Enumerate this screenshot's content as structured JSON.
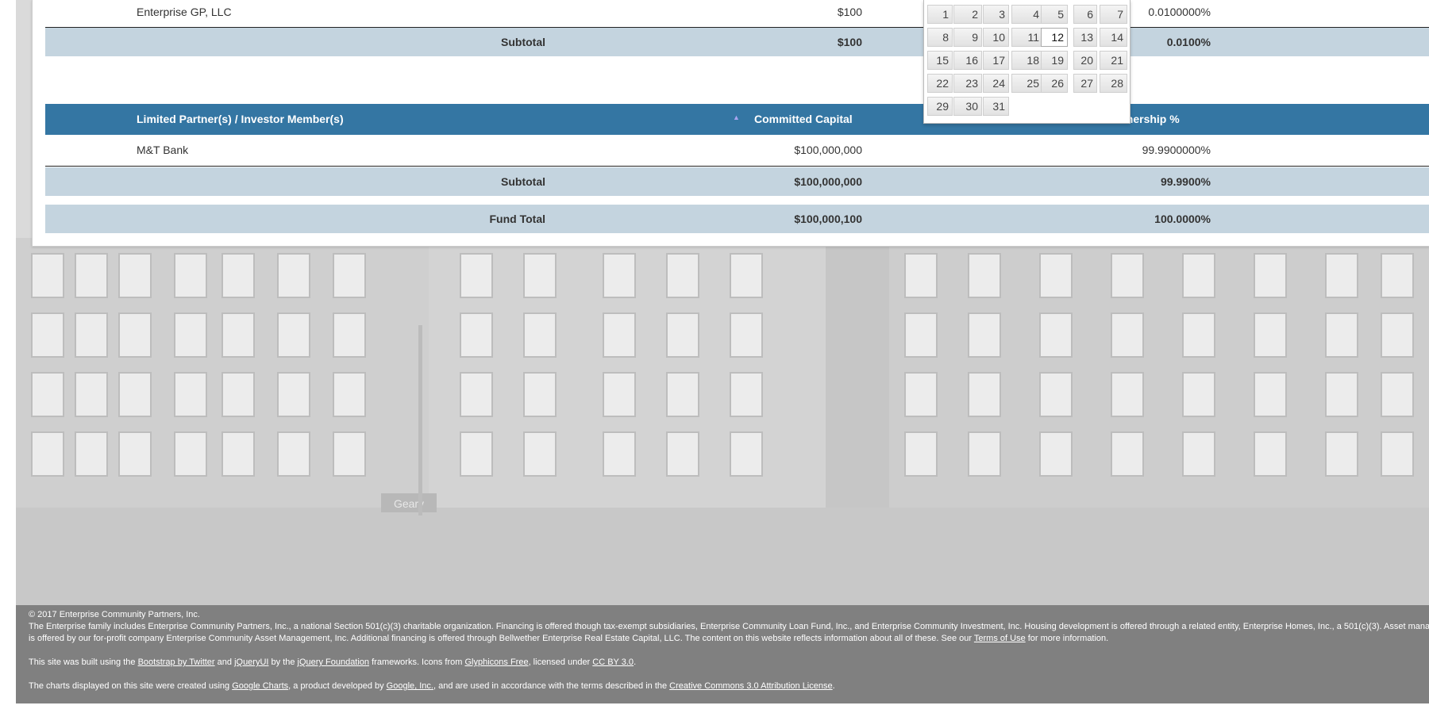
{
  "table": {
    "gp_row": {
      "name": "Enterprise GP, LLC",
      "capital": "$100",
      "ownership": "0.0100000%"
    },
    "gp_subtotal": {
      "label": "Subtotal",
      "capital": "$100",
      "ownership": "0.0100%"
    },
    "lp_header": {
      "col1": "Limited Partner(s) / Investor Member(s)",
      "col2": "Committed Capital",
      "col3": "Ownership %",
      "sort_icon": "sort-asc-icon"
    },
    "lp_row": {
      "name": "M&T Bank",
      "capital": "$100,000,000",
      "ownership": "99.9900000%"
    },
    "lp_subtotal": {
      "label": "Subtotal",
      "capital": "$100,000,000",
      "ownership": "99.9900%"
    },
    "fund_total": {
      "label": "Fund Total",
      "capital": "$100,000,100",
      "ownership": "100.0000%"
    }
  },
  "datepicker": {
    "days": [
      "1",
      "2",
      "3",
      "4",
      "5",
      "6",
      "7",
      "8",
      "9",
      "10",
      "11",
      "12",
      "13",
      "14",
      "15",
      "16",
      "17",
      "18",
      "19",
      "20",
      "21",
      "22",
      "23",
      "24",
      "25",
      "26",
      "27",
      "28",
      "29",
      "30",
      "31"
    ],
    "today": "12"
  },
  "footer": {
    "copyright": "© 2017 Enterprise Community Partners, Inc.",
    "disclaimer_line1": "The Enterprise family includes Enterprise Community Partners, Inc., a national Section 501(c)(3) charitable organization. Financing is offered though tax-exempt subsidiaries, Enterprise Community Loan Fund, Inc., and Enterprise Community Investment, Inc. Housing development is offered through a related entity, Enterprise Homes, Inc., a 501(c)(3). Asset management",
    "disclaimer_line2_pre": "is offered by our for-profit company Enterprise Community Asset Management, Inc. Additional financing is offered through Bellwether Enterprise Real Estate Capital, LLC. The content on this website reflects information about all of these. See our ",
    "terms_link": "Terms of Use",
    "disclaimer_line2_post": " for more information.",
    "built_pre": "This site was built using the ",
    "bootstrap_link": "Bootstrap by Twitter",
    "built_and": " and ",
    "jqueryui_link": "jQueryUI",
    "built_by": " by the ",
    "jqfoundation_link": "jQuery Foundation",
    "built_icons": " frameworks. Icons from ",
    "glyphicons_link": "Glyphicons Free",
    "built_licensed": ", licensed under ",
    "ccby_link": "CC BY 3.0",
    "built_end": ".",
    "charts_pre": "The charts displayed on this site were created using ",
    "gcharts_link": "Google Charts",
    "charts_mid": ", a product developed by ",
    "google_link": "Google, Inc.",
    "charts_mid2": ", and are used in accordance with the terms described in the ",
    "cc_attr_link": "Creative Commons 3.0 Attribution License",
    "charts_end": "."
  },
  "background": {
    "sign_text": "Geary",
    "color": "#d9d9d9"
  }
}
